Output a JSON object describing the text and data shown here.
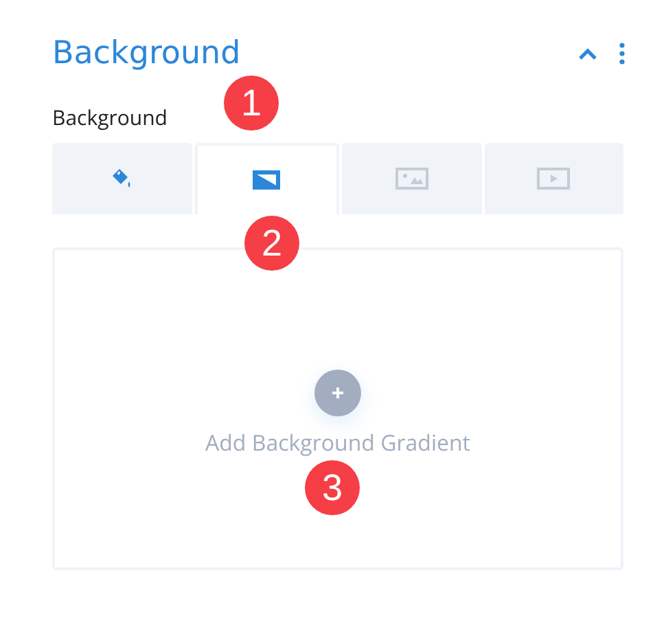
{
  "section": {
    "title": "Background",
    "expanded": true
  },
  "field": {
    "label": "Background"
  },
  "tabs": [
    {
      "kind": "color",
      "selected": false,
      "active": true
    },
    {
      "kind": "gradient",
      "selected": true,
      "active": true
    },
    {
      "kind": "image",
      "selected": false,
      "active": false
    },
    {
      "kind": "video",
      "selected": false,
      "active": false
    }
  ],
  "panel": {
    "add_label": "Add Background Gradient"
  },
  "callouts": [
    {
      "label": "1"
    },
    {
      "label": "2"
    },
    {
      "label": "3"
    }
  ]
}
